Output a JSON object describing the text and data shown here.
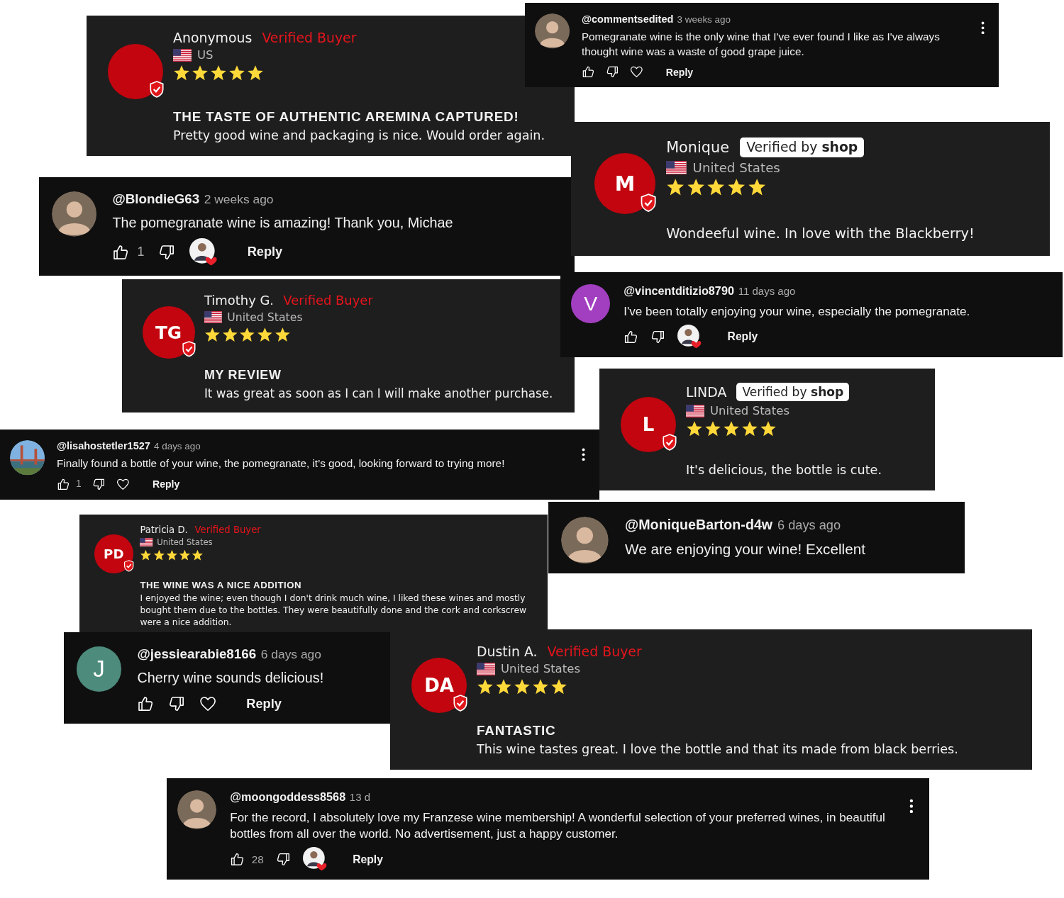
{
  "cards": [
    {
      "kind": "review",
      "name": "Anonymous",
      "badge": {
        "kind": "verified_buyer",
        "text": "Verified Buyer"
      },
      "country": "US",
      "stars": 5,
      "title": "THE TASTE OF AUTHENTIC AREMINA CAPTURED!",
      "body": "Pretty good wine and packaging is nice. Would order again."
    },
    {
      "kind": "comment",
      "avatar": {
        "kind": "person"
      },
      "handle": "@commentsedited",
      "time": "3 weeks ago",
      "text": "Pomegranate wine is the only wine that I've ever found I like as I've always thought wine was a waste of good grape juice.",
      "menu": true,
      "actions": [
        {
          "kind": "like"
        },
        {
          "kind": "dislike"
        },
        {
          "kind": "heart"
        },
        {
          "kind": "reply",
          "label": "Reply"
        }
      ]
    },
    {
      "kind": "comment",
      "avatar": {
        "kind": "person"
      },
      "handle": "@BlondieG63",
      "time": "2 weeks ago",
      "text": "The pomegranate wine is amazing! Thank you, Michae",
      "menu": false,
      "actions": [
        {
          "kind": "like",
          "label": "1"
        },
        {
          "kind": "dislike"
        },
        {
          "kind": "creator_heart"
        },
        {
          "kind": "reply",
          "label": "Reply"
        }
      ]
    },
    {
      "kind": "review",
      "name": "Monique",
      "initials": "M",
      "badge": {
        "kind": "verified_shop",
        "text": "Verified by **shop**"
      },
      "country": "United States",
      "stars": 5,
      "body": "Wondeeful wine. In love with the Blackberry!"
    },
    {
      "kind": "review",
      "name": "Timothy G.",
      "initials": "TG",
      "badge": {
        "kind": "verified_buyer",
        "text": "Verified Buyer"
      },
      "country": "United States",
      "stars": 5,
      "title": "MY REVIEW",
      "body": "It was great as soon as I can I will make another purchase."
    },
    {
      "kind": "comment",
      "avatar": {
        "kind": "letter",
        "letter": "V",
        "color": "#a23fc0"
      },
      "handle": "@vincentditizio8790",
      "time": "11 days ago",
      "text": "I've been totally enjoying your wine, especially the pomegranate.",
      "menu": false,
      "actions": [
        {
          "kind": "like"
        },
        {
          "kind": "dislike"
        },
        {
          "kind": "creator_heart"
        },
        {
          "kind": "reply",
          "label": "Reply"
        }
      ]
    },
    {
      "kind": "review",
      "name": "LINDA",
      "initials": "L",
      "badge": {
        "kind": "verified_shop",
        "text": "Verified by **shop**"
      },
      "country": "United States",
      "stars": 5,
      "body": "It's delicious, the bottle is cute."
    },
    {
      "kind": "comment",
      "avatar": {
        "kind": "scene"
      },
      "handle": "@lisahostetler1527",
      "time": "4 days ago",
      "text": "Finally found a bottle of your wine, the pomegranate, it’s good, looking forward to trying more!",
      "menu": true,
      "actions": [
        {
          "kind": "like",
          "label": "1"
        },
        {
          "kind": "dislike"
        },
        {
          "kind": "heart"
        },
        {
          "kind": "reply",
          "label": "Reply"
        }
      ]
    },
    {
      "kind": "review",
      "name": "Patricia D.",
      "initials": "PD",
      "badge": {
        "kind": "verified_buyer",
        "text": "Verified Buyer"
      },
      "country": "United States",
      "stars": 5,
      "title": "THE WINE WAS A NICE ADDITION",
      "body": "I enjoyed the wine; even though I don't drink much wine, I liked these wines and mostly bought them due to the bottles. They were beautifully done and the cork and corkscrew were a nice addition."
    },
    {
      "kind": "comment",
      "avatar": {
        "kind": "person"
      },
      "handle": "@MoniqueBarton-d4w",
      "time": "6 days ago",
      "text": "We are enjoying your wine! Excellent",
      "menu": false
    },
    {
      "kind": "comment",
      "avatar": {
        "kind": "letter",
        "letter": "J",
        "color": "#4d8b7c"
      },
      "handle": "@jessiearabie8166",
      "time": "6 days ago",
      "text": "Cherry wine sounds delicious!",
      "menu": false,
      "actions": [
        {
          "kind": "like"
        },
        {
          "kind": "dislike"
        },
        {
          "kind": "heart"
        },
        {
          "kind": "reply",
          "label": "Reply"
        }
      ]
    },
    {
      "kind": "review",
      "name": "Dustin A.",
      "initials": "DA",
      "badge": {
        "kind": "verified_buyer",
        "text": "Verified Buyer"
      },
      "country": "United States",
      "stars": 5,
      "title": "FANTASTIC",
      "body": "This wine tastes great. I love the bottle and that its made from black berries."
    },
    {
      "kind": "comment",
      "avatar": {
        "kind": "person"
      },
      "handle": "@moongoddess8568",
      "time": "13 d",
      "text": "For the record, I absolutely love my Franzese wine membership! A wonderful selection of your preferred wines, in beautiful bottles from all over the world. No advertisement, just a happy customer.",
      "menu": true,
      "actions": [
        {
          "kind": "like",
          "label": "28"
        },
        {
          "kind": "dislike"
        },
        {
          "kind": "creator_heart"
        },
        {
          "kind": "reply",
          "label": "Reply"
        }
      ]
    }
  ]
}
